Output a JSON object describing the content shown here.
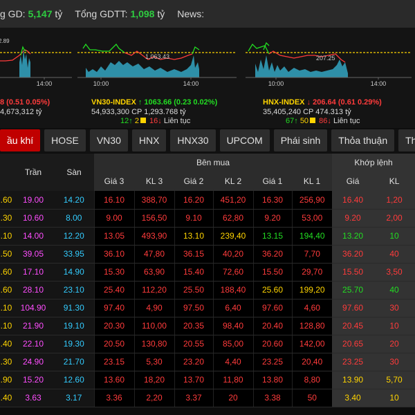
{
  "topbar": {
    "items": [
      {
        "label": "g GD: ",
        "value": "5,147",
        "unit": " tỷ"
      },
      {
        "label": "Tổng GDTT: ",
        "value": "1,098",
        "unit": " tỷ"
      },
      {
        "label": "News:",
        "value": "",
        "unit": ""
      }
    ]
  },
  "charts": [
    {
      "name": "",
      "label_top": "2.89",
      "label_mid": "",
      "time1": "",
      "time2": "14:00",
      "line1": {
        "value": "",
        "arrow": "",
        "change": "8  (0.51  0.05%)",
        "color": "red"
      },
      "line2": "4,673,312 tỷ",
      "line3": ""
    },
    {
      "name": "VN30-INDEX",
      "label_top": "",
      "label_mid": "1,063.43",
      "time1": "10:00",
      "time2": "14:00",
      "line1": {
        "value": "1063.66",
        "arrow": "↑",
        "change": "(0.23  0.02%)",
        "color": "green"
      },
      "line2": "54,933,300 CP 1,293.768 tỷ",
      "line3": {
        "up": "12",
        "up_arrow": "↑",
        "ref": "2",
        "down": "16",
        "down_arrow": "↓",
        "status": "Liên tục"
      }
    },
    {
      "name": "HNX-INDEX",
      "label_top": "",
      "label_mid": "207.25",
      "time1": "10:00",
      "time2": "14:00",
      "line1": {
        "value": "206.64",
        "arrow": "↓",
        "change": "(0.61  0.29%)",
        "color": "red"
      },
      "line2": "35,405,240 CP 474.313 tỷ",
      "line3": {
        "up": "67",
        "up_arrow": "↑",
        "ref": "50",
        "down": "86",
        "down_arrow": "↓",
        "status": "Liên tục"
      }
    }
  ],
  "tabs": [
    {
      "label": "ầu khí",
      "active": true
    },
    {
      "label": "HOSE",
      "active": false
    },
    {
      "label": "VN30",
      "active": false
    },
    {
      "label": "HNX",
      "active": false
    },
    {
      "label": "HNX30",
      "active": false
    },
    {
      "label": "UPCOM",
      "active": false
    },
    {
      "label": "Phái sinh",
      "active": false
    },
    {
      "label": "Thỏa thuận",
      "active": false
    },
    {
      "label": "Thống kê",
      "active": false
    }
  ],
  "table": {
    "group_buy": "Bên mua",
    "group_khop": "Khớp lệnh",
    "headers": [
      "",
      "Trần",
      "Sàn",
      "Giá 3",
      "KL 3",
      "Giá 2",
      "KL 2",
      "Giá 1",
      "KL 1",
      "Giá",
      "KL"
    ],
    "rows": [
      [
        ".60",
        "19.00",
        "14.20",
        "16.10",
        "388,70",
        "16.20",
        "451,20",
        "16.30",
        "256,90",
        "16.40",
        "1,20"
      ],
      [
        ".30",
        "10.60",
        "8.00",
        "9.00",
        "156,50",
        "9.10",
        "62,80",
        "9.20",
        "53,00",
        "9.20",
        "2,00"
      ],
      [
        ".10",
        "14.00",
        "12.20",
        "13.05",
        "493,90",
        "13.10",
        "239,40",
        "13.15",
        "194,40",
        "13.20",
        "10"
      ],
      [
        ".50",
        "39.05",
        "33.95",
        "36.10",
        "47,80",
        "36.15",
        "40,20",
        "36.20",
        "7,70",
        "36.20",
        "40"
      ],
      [
        ".60",
        "17.10",
        "14.90",
        "15.30",
        "63,90",
        "15.40",
        "72,60",
        "15.50",
        "29,70",
        "15.50",
        "3,50"
      ],
      [
        ".60",
        "28.10",
        "23.10",
        "25.40",
        "112,20",
        "25.50",
        "188,40",
        "25.60",
        "199,20",
        "25.70",
        "40"
      ],
      [
        ".10",
        "104.90",
        "91.30",
        "97.40",
        "4,90",
        "97.50",
        "6,40",
        "97.60",
        "4,60",
        "97.60",
        "30"
      ],
      [
        ".10",
        "21.90",
        "19.10",
        "20.30",
        "110,00",
        "20.35",
        "98,40",
        "20.40",
        "128,80",
        "20.45",
        "10"
      ],
      [
        ".40",
        "22.10",
        "19.30",
        "20.50",
        "130,80",
        "20.55",
        "85,00",
        "20.60",
        "142,00",
        "20.65",
        "20"
      ],
      [
        ".30",
        "24.90",
        "21.70",
        "23.15",
        "5,30",
        "23.20",
        "4,40",
        "23.25",
        "20,40",
        "23.25",
        "30"
      ],
      [
        ".90",
        "15.20",
        "12.60",
        "13.60",
        "18,20",
        "13.70",
        "11,80",
        "13.80",
        "8,80",
        "13.90",
        "5,70"
      ],
      [
        ".40",
        "3.63",
        "3.17",
        "3.36",
        "2,20",
        "3.37",
        "20",
        "3.38",
        "50",
        "3.40",
        "10"
      ]
    ],
    "colors": [
      [
        "y",
        "p",
        "c",
        "r",
        "r",
        "r",
        "r",
        "r",
        "r",
        "r",
        "r"
      ],
      [
        "y",
        "p",
        "c",
        "r",
        "r",
        "r",
        "r",
        "r",
        "r",
        "r",
        "r"
      ],
      [
        "y",
        "p",
        "c",
        "r",
        "r",
        "y",
        "y",
        "g",
        "g",
        "g",
        "g"
      ],
      [
        "y",
        "p",
        "c",
        "r",
        "r",
        "r",
        "r",
        "r",
        "r",
        "r",
        "r"
      ],
      [
        "y",
        "p",
        "c",
        "r",
        "r",
        "r",
        "r",
        "r",
        "r",
        "r",
        "r"
      ],
      [
        "y",
        "p",
        "c",
        "r",
        "r",
        "r",
        "r",
        "y",
        "y",
        "g",
        "g"
      ],
      [
        "y",
        "p",
        "c",
        "r",
        "r",
        "r",
        "r",
        "r",
        "r",
        "r",
        "r"
      ],
      [
        "y",
        "p",
        "c",
        "r",
        "r",
        "r",
        "r",
        "r",
        "r",
        "r",
        "r"
      ],
      [
        "y",
        "p",
        "c",
        "r",
        "r",
        "r",
        "r",
        "r",
        "r",
        "r",
        "r"
      ],
      [
        "y",
        "p",
        "c",
        "r",
        "r",
        "r",
        "r",
        "r",
        "r",
        "r",
        "r"
      ],
      [
        "y",
        "p",
        "c",
        "r",
        "r",
        "r",
        "r",
        "r",
        "r",
        "y",
        "y"
      ],
      [
        "y",
        "p",
        "c",
        "r",
        "r",
        "r",
        "r",
        "r",
        "r",
        "y",
        "y"
      ]
    ]
  }
}
